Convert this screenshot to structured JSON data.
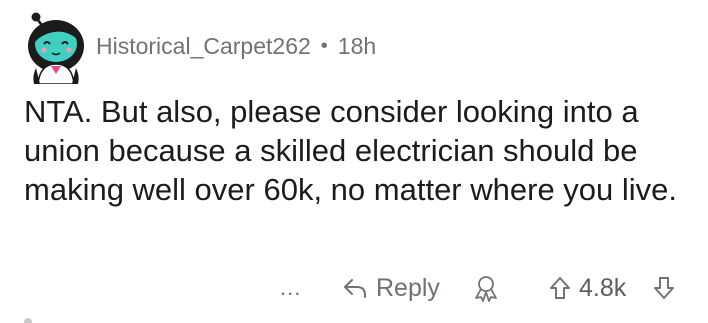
{
  "comment": {
    "username": "Historical_Carpet262",
    "separator": "•",
    "time_ago": "18h",
    "body": "NTA. But also, please consider looking into a union because a skilled electrician should be making well over 60k, no matter where you live.",
    "actions": {
      "more_label": "...",
      "reply_label": "Reply",
      "score": "4.8k"
    }
  },
  "icons": {
    "avatar": "avatar-icon",
    "reply": "reply-arrow-icon",
    "award": "award-icon",
    "upvote": "upvote-arrow-icon",
    "downvote": "downvote-arrow-icon"
  },
  "colors": {
    "text": "#1c1c1c",
    "meta": "#6f7375",
    "avatar_skin": "#3fd0c2",
    "avatar_hair": "#1b1b1b",
    "avatar_shirt": "#ffffff",
    "avatar_bg": "#ffffff"
  }
}
